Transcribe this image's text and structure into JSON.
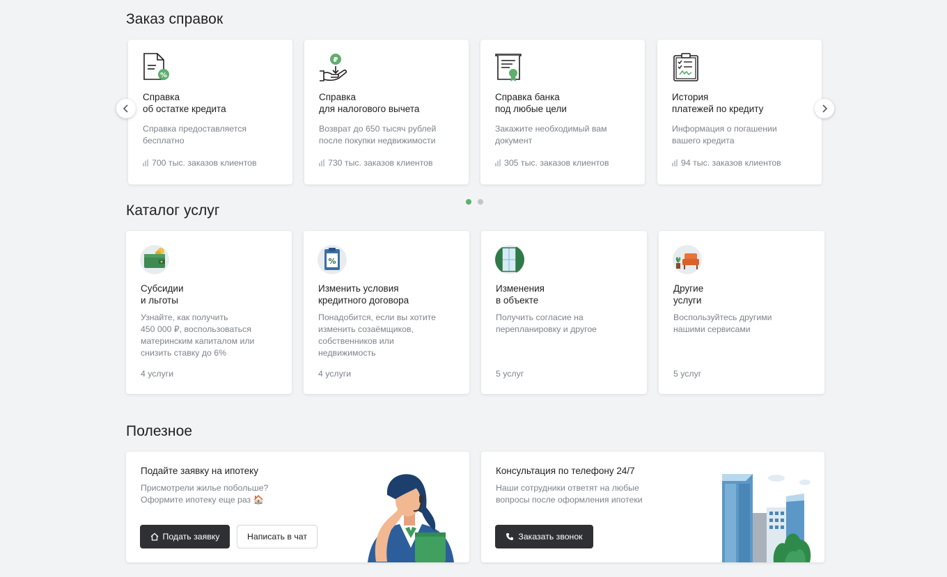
{
  "orders": {
    "title": "Заказ справок",
    "cards": [
      {
        "icon": "document-percent-icon",
        "title_l1": "Справка",
        "title_l2": "об остатке кредита",
        "desc_l1": "Справка предоставляется",
        "desc_l2": "бесплатно",
        "stat": "700 тыс. заказов клиентов"
      },
      {
        "icon": "ruble-hand-icon",
        "title_l1": "Справка",
        "title_l2": "для налогового вычета",
        "desc_l1": "Возврат до 650 тысяч рублей",
        "desc_l2": "после покупки недвижимости",
        "stat": "730 тыс. заказов клиентов"
      },
      {
        "icon": "certificate-icon",
        "title_l1": "Справка банка",
        "title_l2": "под любые цели",
        "desc_l1": "Закажите необходимый вам",
        "desc_l2": "документ",
        "stat": "305 тыс. заказов клиентов"
      },
      {
        "icon": "clipboard-checklist-icon",
        "title_l1": "История",
        "title_l2": "платежей по кредиту",
        "desc_l1": "Информация о погашении",
        "desc_l2": "вашего кредита",
        "stat": "94 тыс. заказов клиентов"
      }
    ],
    "pages": 2,
    "active_page": 1
  },
  "catalog": {
    "title": "Каталог услуг",
    "cards": [
      {
        "icon": "wallet-coins-icon",
        "title_l1": "Субсидии",
        "title_l2": "и льготы",
        "desc": [
          "Узнайте, как получить",
          "450 000 ₽, воспользоваться",
          "материнским капиталом или",
          "снизить ставку до 6%"
        ],
        "count": "4 услуги"
      },
      {
        "icon": "percent-document-icon",
        "title_l1": "Изменить условия",
        "title_l2": "кредитного договора",
        "desc": [
          "Понадобится, если вы хотите",
          "изменить созаёмщиков,",
          "собственников или",
          "недвижимость"
        ],
        "count": "4 услуги"
      },
      {
        "icon": "window-icon",
        "title_l1": "Изменения",
        "title_l2": "в объекте",
        "desc": [
          "Получить согласие на",
          "перепланировку и другое"
        ],
        "count": "5 услуг"
      },
      {
        "icon": "armchair-plant-icon",
        "title_l1": "Другие",
        "title_l2": "услуги",
        "desc": [
          "Воспользуйтесь другими",
          "нашими сервисами"
        ],
        "count": "5 услуг"
      }
    ]
  },
  "useful": {
    "title": "Полезное",
    "mortgage": {
      "title": "Подайте заявку на ипотеку",
      "desc_l1": "Присмотрели жилье побольше?",
      "desc_l2": "Оформите ипотеку еще раз 🏠",
      "apply_label": "Подать заявку",
      "chat_label": "Написать в чат"
    },
    "phone": {
      "title": "Консультация по телефону 24/7",
      "desc_l1": "Наши сотрудники ответят на любые",
      "desc_l2": "вопросы после оформления ипотеки",
      "call_label": "Заказать звонок"
    }
  },
  "colors": {
    "accent": "#5fae6e",
    "dark_button": "#2f3033",
    "muted_text": "#7d838a",
    "background": "#f2f3f5"
  }
}
